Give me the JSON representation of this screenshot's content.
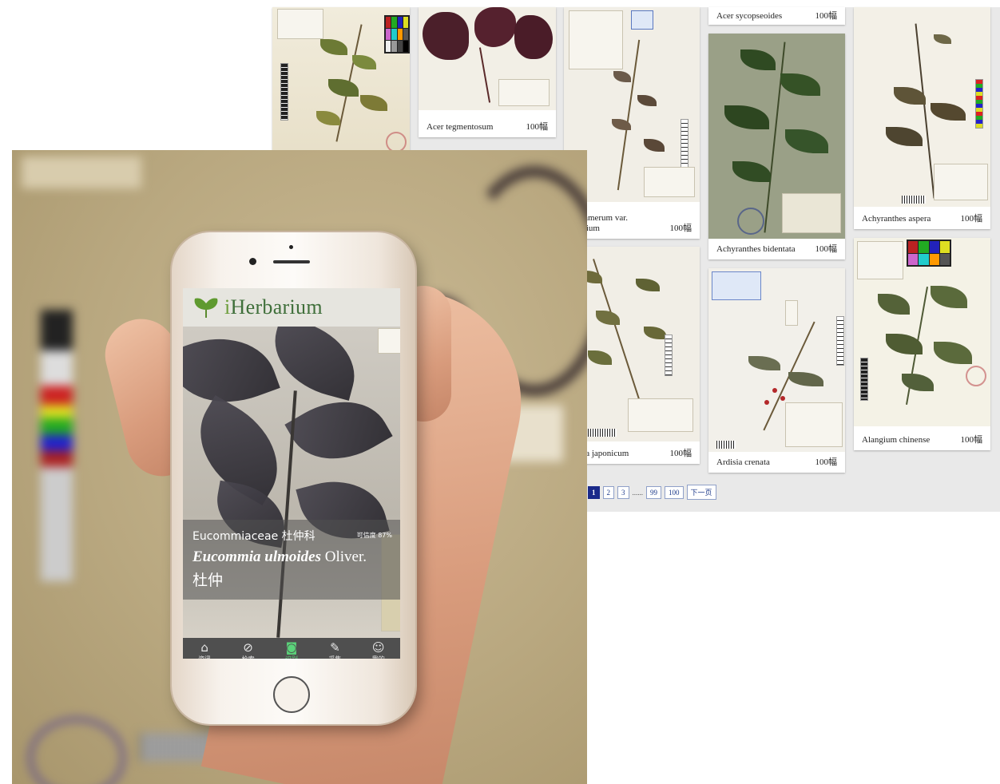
{
  "web_grid": {
    "cards": [
      {
        "name": "",
        "count": ""
      },
      {
        "name": "Acer tegmentosum",
        "count": "100幅"
      },
      {
        "name": "r tetramerum var.\nolifolium",
        "count": "100幅"
      },
      {
        "name": "Acer sycopseoides",
        "count": "100幅"
      },
      {
        "name": "Achyranthes bidentata",
        "count": "100幅"
      },
      {
        "name": "Achyranthes aspera",
        "count": "100幅"
      },
      {
        "name": "desma japonicum",
        "count": "100幅"
      },
      {
        "name": "Ardisia crenata",
        "count": "100幅"
      },
      {
        "name": "Alangium chinense",
        "count": "100幅"
      }
    ],
    "pagination": [
      "1",
      "2",
      "3",
      "......",
      "99",
      "100",
      "下一页"
    ],
    "active_page": "1"
  },
  "app": {
    "title_first": "i",
    "title_rest": "Herbarium",
    "result": {
      "family": "Eucommiaceae 杜仲科",
      "confidence": "可信度 87%",
      "genus_species": "Eucommia ulmoides",
      "author": "Oliver.",
      "chinese_name": "杜仲"
    },
    "tabs": [
      {
        "label": "资讯",
        "icon": "home-icon",
        "glyph": "⌂",
        "active": false
      },
      {
        "label": "检索",
        "icon": "search-leaf-icon",
        "glyph": "⊘",
        "active": false
      },
      {
        "label": "识别",
        "icon": "camera-icon",
        "glyph": "◙",
        "active": true
      },
      {
        "label": "采集",
        "icon": "collect-leaf-icon",
        "glyph": "✎",
        "active": false
      },
      {
        "label": "我的",
        "icon": "profile-icon",
        "glyph": "☺",
        "active": false
      }
    ]
  },
  "colors": {
    "accent_green": "#5bd37a",
    "logo_green": "#6c9d3a",
    "pager_active": "#1a2a8a"
  }
}
